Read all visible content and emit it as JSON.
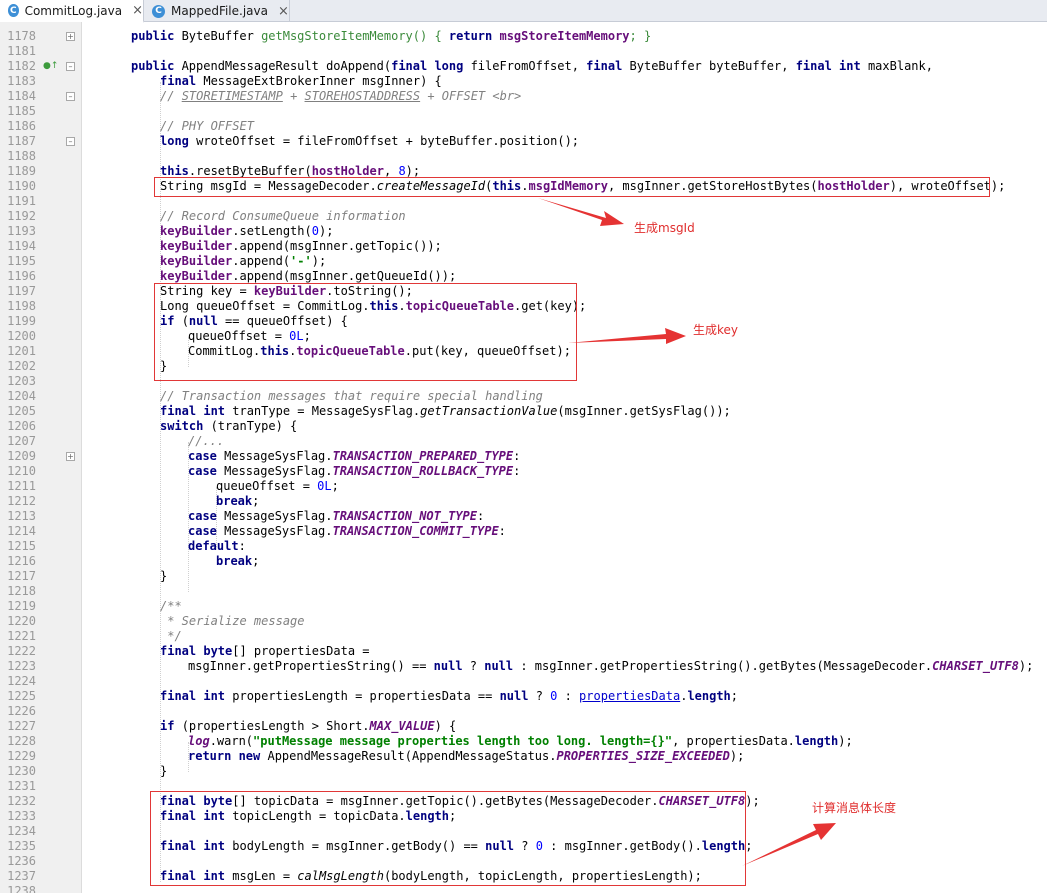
{
  "tabs": [
    {
      "label": "CommitLog.java",
      "icon": "java-class-icon",
      "active": true,
      "close": "×"
    },
    {
      "label": "MappedFile.java",
      "icon": "java-class-icon",
      "active": false,
      "close": "×"
    }
  ],
  "annotations": [
    {
      "text": "生成msgId"
    },
    {
      "text": "生成key"
    },
    {
      "text": "计算消息体长度"
    }
  ],
  "colors": {
    "keyword": "#000080",
    "comment": "#808080",
    "field": "#660e7a",
    "string": "#008000",
    "number": "#0000ff",
    "highlight_box": "#e13737"
  },
  "lines": [
    {
      "no": "1178",
      "segs": [
        [
          "k",
          "public "
        ],
        [
          "",
          "ByteBuffer "
        ],
        [
          "fo",
          "getMsgStoreItemMemory"
        ],
        [
          "fo",
          "() { "
        ],
        [
          "k",
          "return "
        ],
        [
          "f",
          "msgStoreItemMemory"
        ],
        [
          "fo",
          "; }"
        ]
      ]
    },
    {
      "no": "1181",
      "segs": []
    },
    {
      "no": "1182",
      "segs": [
        [
          "k",
          "public "
        ],
        [
          "",
          "AppendMessageResult doAppend("
        ],
        [
          "k",
          "final long "
        ],
        [
          "",
          "fileFromOffset, "
        ],
        [
          "k",
          "final "
        ],
        [
          "",
          "ByteBuffer byteBuffer, "
        ],
        [
          "k",
          "final int "
        ],
        [
          "",
          "maxBlank,"
        ]
      ]
    },
    {
      "no": "1183",
      "segs": [
        [
          "k",
          "final "
        ],
        [
          "",
          "MessageExtBrokerInner msgInner) {"
        ]
      ]
    },
    {
      "no": "1184",
      "segs": [
        [
          "cm",
          "// "
        ],
        [
          "cm u",
          "STORETIMESTAMP"
        ],
        [
          "cm",
          " + "
        ],
        [
          "cm u",
          "STOREHOSTADDRESS"
        ],
        [
          "cm",
          " + OFFSET <br>"
        ]
      ]
    },
    {
      "no": "1185",
      "segs": []
    },
    {
      "no": "1186",
      "segs": [
        [
          "cm",
          "// PHY OFFSET"
        ]
      ]
    },
    {
      "no": "1187",
      "segs": [
        [
          "k",
          "long "
        ],
        [
          "",
          "wroteOffset = fileFromOffset + byteBuffer.position();"
        ]
      ]
    },
    {
      "no": "1188",
      "segs": []
    },
    {
      "no": "1189",
      "segs": [
        [
          "k",
          "this"
        ],
        [
          "",
          ".resetByteBuffer("
        ],
        [
          "f",
          "hostHolder"
        ],
        [
          "",
          ", "
        ],
        [
          "n",
          "8"
        ],
        [
          "",
          ");"
        ]
      ]
    },
    {
      "no": "1190",
      "segs": [
        [
          "",
          "String msgId = MessageDecoder."
        ],
        [
          "im",
          "createMessageId"
        ],
        [
          "",
          "("
        ],
        [
          "k",
          "this"
        ],
        [
          "",
          "."
        ],
        [
          "f",
          "msgIdMemory"
        ],
        [
          "",
          ", msgInner.getStoreHostBytes("
        ],
        [
          "f",
          "hostHolder"
        ],
        [
          "",
          "), wroteOffset);"
        ]
      ]
    },
    {
      "no": "1191",
      "segs": []
    },
    {
      "no": "1192",
      "segs": [
        [
          "cm",
          "// Record ConsumeQueue information"
        ]
      ]
    },
    {
      "no": "1193",
      "segs": [
        [
          "f",
          "keyBuilder"
        ],
        [
          "",
          ".setLength("
        ],
        [
          "n",
          "0"
        ],
        [
          "",
          ");"
        ]
      ]
    },
    {
      "no": "1194",
      "segs": [
        [
          "f",
          "keyBuilder"
        ],
        [
          "",
          ".append(msgInner.getTopic());"
        ]
      ]
    },
    {
      "no": "1195",
      "segs": [
        [
          "f",
          "keyBuilder"
        ],
        [
          "",
          ".append("
        ],
        [
          "s",
          "'-'"
        ],
        [
          "",
          ");"
        ]
      ]
    },
    {
      "no": "1196",
      "segs": [
        [
          "f",
          "keyBuilder"
        ],
        [
          "",
          ".append(msgInner.getQueueId());"
        ]
      ]
    },
    {
      "no": "1197",
      "segs": [
        [
          "",
          "String key = "
        ],
        [
          "f",
          "keyBuilder"
        ],
        [
          "",
          ".toString();"
        ]
      ]
    },
    {
      "no": "1198",
      "segs": [
        [
          "",
          "Long queueOffset = CommitLog."
        ],
        [
          "k",
          "this"
        ],
        [
          "",
          "."
        ],
        [
          "f",
          "topicQueueTable"
        ],
        [
          "",
          ".get(key);"
        ]
      ]
    },
    {
      "no": "1199",
      "segs": [
        [
          "k",
          "if "
        ],
        [
          "",
          "("
        ],
        [
          "k",
          "null "
        ],
        [
          "",
          "== queueOffset) {"
        ]
      ]
    },
    {
      "no": "1200",
      "segs": [
        [
          "",
          "queueOffset = "
        ],
        [
          "n",
          "0L"
        ],
        [
          "",
          ";"
        ]
      ]
    },
    {
      "no": "1201",
      "segs": [
        [
          "",
          "CommitLog."
        ],
        [
          "k",
          "this"
        ],
        [
          "",
          "."
        ],
        [
          "f",
          "topicQueueTable"
        ],
        [
          "",
          ".put(key, queueOffset);"
        ]
      ]
    },
    {
      "no": "1202",
      "segs": [
        [
          "",
          "}"
        ]
      ]
    },
    {
      "no": "1203",
      "segs": []
    },
    {
      "no": "1204",
      "segs": [
        [
          "cm",
          "// Transaction messages that require special handling"
        ]
      ]
    },
    {
      "no": "1205",
      "segs": [
        [
          "k",
          "final int "
        ],
        [
          "",
          "tranType = MessageSysFlag."
        ],
        [
          "im",
          "getTransactionValue"
        ],
        [
          "",
          "(msgInner.getSysFlag());"
        ]
      ]
    },
    {
      "no": "1206",
      "segs": [
        [
          "k",
          "switch "
        ],
        [
          "",
          "(tranType) {"
        ]
      ]
    },
    {
      "no": "1207",
      "segs": [
        [
          "cm",
          "//..."
        ]
      ]
    },
    {
      "no": "1209",
      "segs": [
        [
          "k",
          "case "
        ],
        [
          "",
          "MessageSysFlag."
        ],
        [
          "st",
          "TRANSACTION_PREPARED_TYPE"
        ],
        [
          "",
          ":"
        ]
      ]
    },
    {
      "no": "1210",
      "segs": [
        [
          "k",
          "case "
        ],
        [
          "",
          "MessageSysFlag."
        ],
        [
          "st",
          "TRANSACTION_ROLLBACK_TYPE"
        ],
        [
          "",
          ":"
        ]
      ]
    },
    {
      "no": "1211",
      "segs": [
        [
          "",
          "queueOffset = "
        ],
        [
          "n",
          "0L"
        ],
        [
          "",
          ";"
        ]
      ]
    },
    {
      "no": "1212",
      "segs": [
        [
          "k",
          "break"
        ],
        [
          "",
          ";"
        ]
      ]
    },
    {
      "no": "1213",
      "segs": [
        [
          "k",
          "case "
        ],
        [
          "",
          "MessageSysFlag."
        ],
        [
          "st",
          "TRANSACTION_NOT_TYPE"
        ],
        [
          "",
          ":"
        ]
      ]
    },
    {
      "no": "1214",
      "segs": [
        [
          "k",
          "case "
        ],
        [
          "",
          "MessageSysFlag."
        ],
        [
          "st",
          "TRANSACTION_COMMIT_TYPE"
        ],
        [
          "",
          ":"
        ]
      ]
    },
    {
      "no": "1215",
      "segs": [
        [
          "k",
          "default"
        ],
        [
          "",
          ":"
        ]
      ]
    },
    {
      "no": "1216",
      "segs": [
        [
          "k",
          "break"
        ],
        [
          "",
          ";"
        ]
      ]
    },
    {
      "no": "1217",
      "segs": [
        [
          "",
          "}"
        ]
      ]
    },
    {
      "no": "1218",
      "segs": []
    },
    {
      "no": "1219",
      "segs": [
        [
          "cm",
          "/**"
        ]
      ]
    },
    {
      "no": "1220",
      "segs": [
        [
          "cm",
          " * Serialize message"
        ]
      ]
    },
    {
      "no": "1221",
      "segs": [
        [
          "cm",
          " */"
        ]
      ]
    },
    {
      "no": "1222",
      "segs": [
        [
          "k",
          "final byte"
        ],
        [
          "",
          "[] propertiesData ="
        ]
      ]
    },
    {
      "no": "1223",
      "segs": [
        [
          "",
          "msgInner.getPropertiesString() == "
        ],
        [
          "k",
          "null "
        ],
        [
          "",
          "? "
        ],
        [
          "k",
          "null "
        ],
        [
          "",
          ": msgInner.getPropertiesString().getBytes(MessageDecoder."
        ],
        [
          "st",
          "CHARSET_UTF8"
        ],
        [
          "",
          ");"
        ]
      ]
    },
    {
      "no": "1224",
      "segs": []
    },
    {
      "no": "1225",
      "segs": [
        [
          "k",
          "final int "
        ],
        [
          "",
          "propertiesLength = propertiesData == "
        ],
        [
          "k",
          "null "
        ],
        [
          "",
          "? "
        ],
        [
          "n",
          "0 "
        ],
        [
          "",
          ": "
        ],
        [
          "lk",
          "propertiesData"
        ],
        [
          "",
          "."
        ],
        [
          "k",
          "length"
        ],
        [
          "",
          ";"
        ]
      ]
    },
    {
      "no": "1226",
      "segs": []
    },
    {
      "no": "1227",
      "segs": [
        [
          "k",
          "if "
        ],
        [
          "",
          "(propertiesLength > Short."
        ],
        [
          "st",
          "MAX_VALUE"
        ],
        [
          "",
          ") {"
        ]
      ]
    },
    {
      "no": "1228",
      "segs": [
        [
          "st",
          "log"
        ],
        [
          "",
          ".warn("
        ],
        [
          "s",
          "\"putMessage message properties length too long. length={}\""
        ],
        [
          "",
          ", propertiesData."
        ],
        [
          "k",
          "length"
        ],
        [
          "",
          ");"
        ]
      ]
    },
    {
      "no": "1229",
      "segs": [
        [
          "k",
          "return new "
        ],
        [
          "",
          "AppendMessageResult(AppendMessageStatus."
        ],
        [
          "st",
          "PROPERTIES_SIZE_EXCEEDED"
        ],
        [
          "",
          ");"
        ]
      ]
    },
    {
      "no": "1230",
      "segs": [
        [
          "",
          "}"
        ]
      ]
    },
    {
      "no": "1231",
      "segs": []
    },
    {
      "no": "1232",
      "segs": [
        [
          "k",
          "final byte"
        ],
        [
          "",
          "[] topicData = msgInner.getTopic().getBytes(MessageDecoder."
        ],
        [
          "st",
          "CHARSET_UTF8"
        ],
        [
          "",
          ");"
        ]
      ]
    },
    {
      "no": "1233",
      "segs": [
        [
          "k",
          "final int "
        ],
        [
          "",
          "topicLength = topicData."
        ],
        [
          "k",
          "length"
        ],
        [
          "",
          ";"
        ]
      ]
    },
    {
      "no": "1234",
      "segs": []
    },
    {
      "no": "1235",
      "segs": [
        [
          "k",
          "final int "
        ],
        [
          "",
          "bodyLength = msgInner.getBody() == "
        ],
        [
          "k",
          "null "
        ],
        [
          "",
          "? "
        ],
        [
          "n",
          "0 "
        ],
        [
          "",
          ": msgInner.getBody()."
        ],
        [
          "k",
          "length"
        ],
        [
          "",
          ";"
        ]
      ]
    },
    {
      "no": "1236",
      "segs": []
    },
    {
      "no": "1237",
      "segs": [
        [
          "k",
          "final int "
        ],
        [
          "",
          "msgLen = "
        ],
        [
          "im",
          "calMsgLength"
        ],
        [
          "",
          "(bodyLength, topicLength, propertiesLength);"
        ]
      ]
    },
    {
      "no": "1238",
      "segs": []
    }
  ]
}
